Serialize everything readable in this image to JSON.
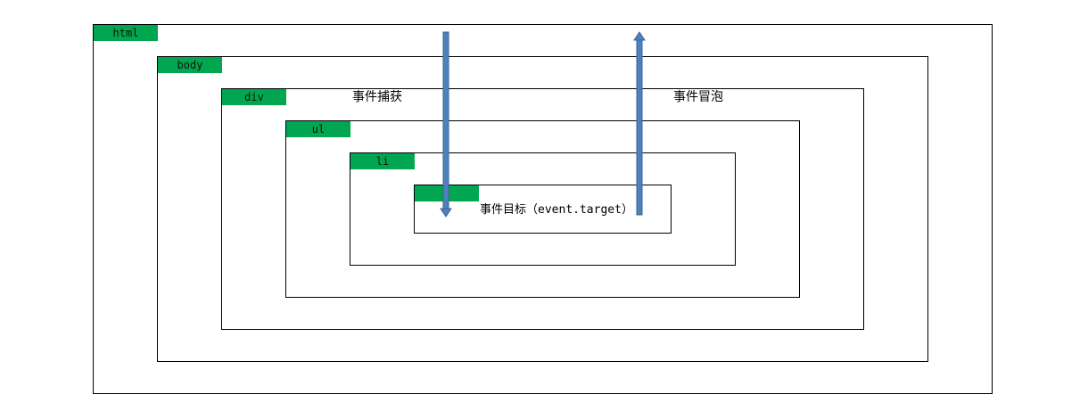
{
  "layers": [
    {
      "tag": "html"
    },
    {
      "tag": "body"
    },
    {
      "tag": "div"
    },
    {
      "tag": "ul"
    },
    {
      "tag": "li"
    },
    {
      "tag": ""
    }
  ],
  "captions": {
    "capture": "事件捕获",
    "bubble": "事件冒泡"
  },
  "target": {
    "prefix": "事件目标（",
    "code": "event.target",
    "suffix": "）"
  },
  "colors": {
    "tag_fill": "#00a650",
    "arrow_fill": "#4f81bd",
    "arrow_stroke": "#3a6491",
    "border": "#000000"
  },
  "icons": {
    "capture_arrow": "arrow-down-icon",
    "bubble_arrow": "arrow-up-icon"
  }
}
